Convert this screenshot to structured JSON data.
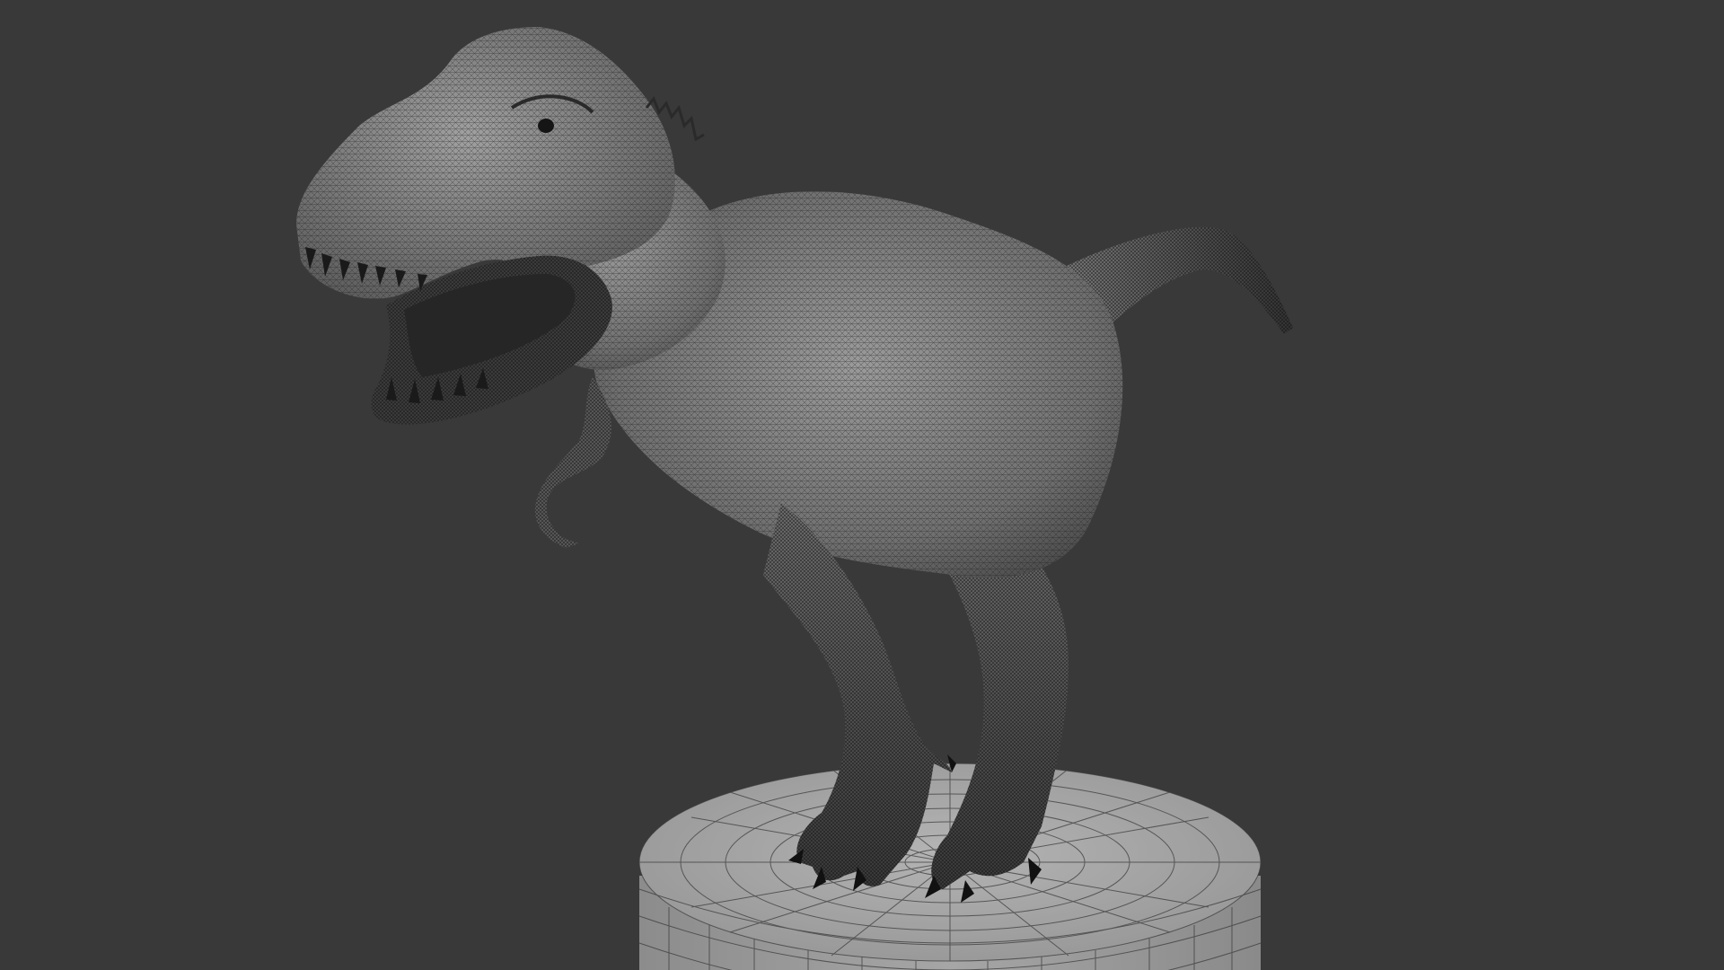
{
  "viewport": {
    "background_color": "#393939",
    "shading": "wireframe-over-solid",
    "objects": [
      {
        "name": "tyrannosaurus-model",
        "surface_color": "#8a8a8a",
        "wire_color": "#1a1a1a",
        "selected": false
      },
      {
        "name": "cylinder-pedestal",
        "surface_color": "#a3a3a3",
        "wire_color": "#3c3c3c",
        "selected": false
      }
    ]
  }
}
